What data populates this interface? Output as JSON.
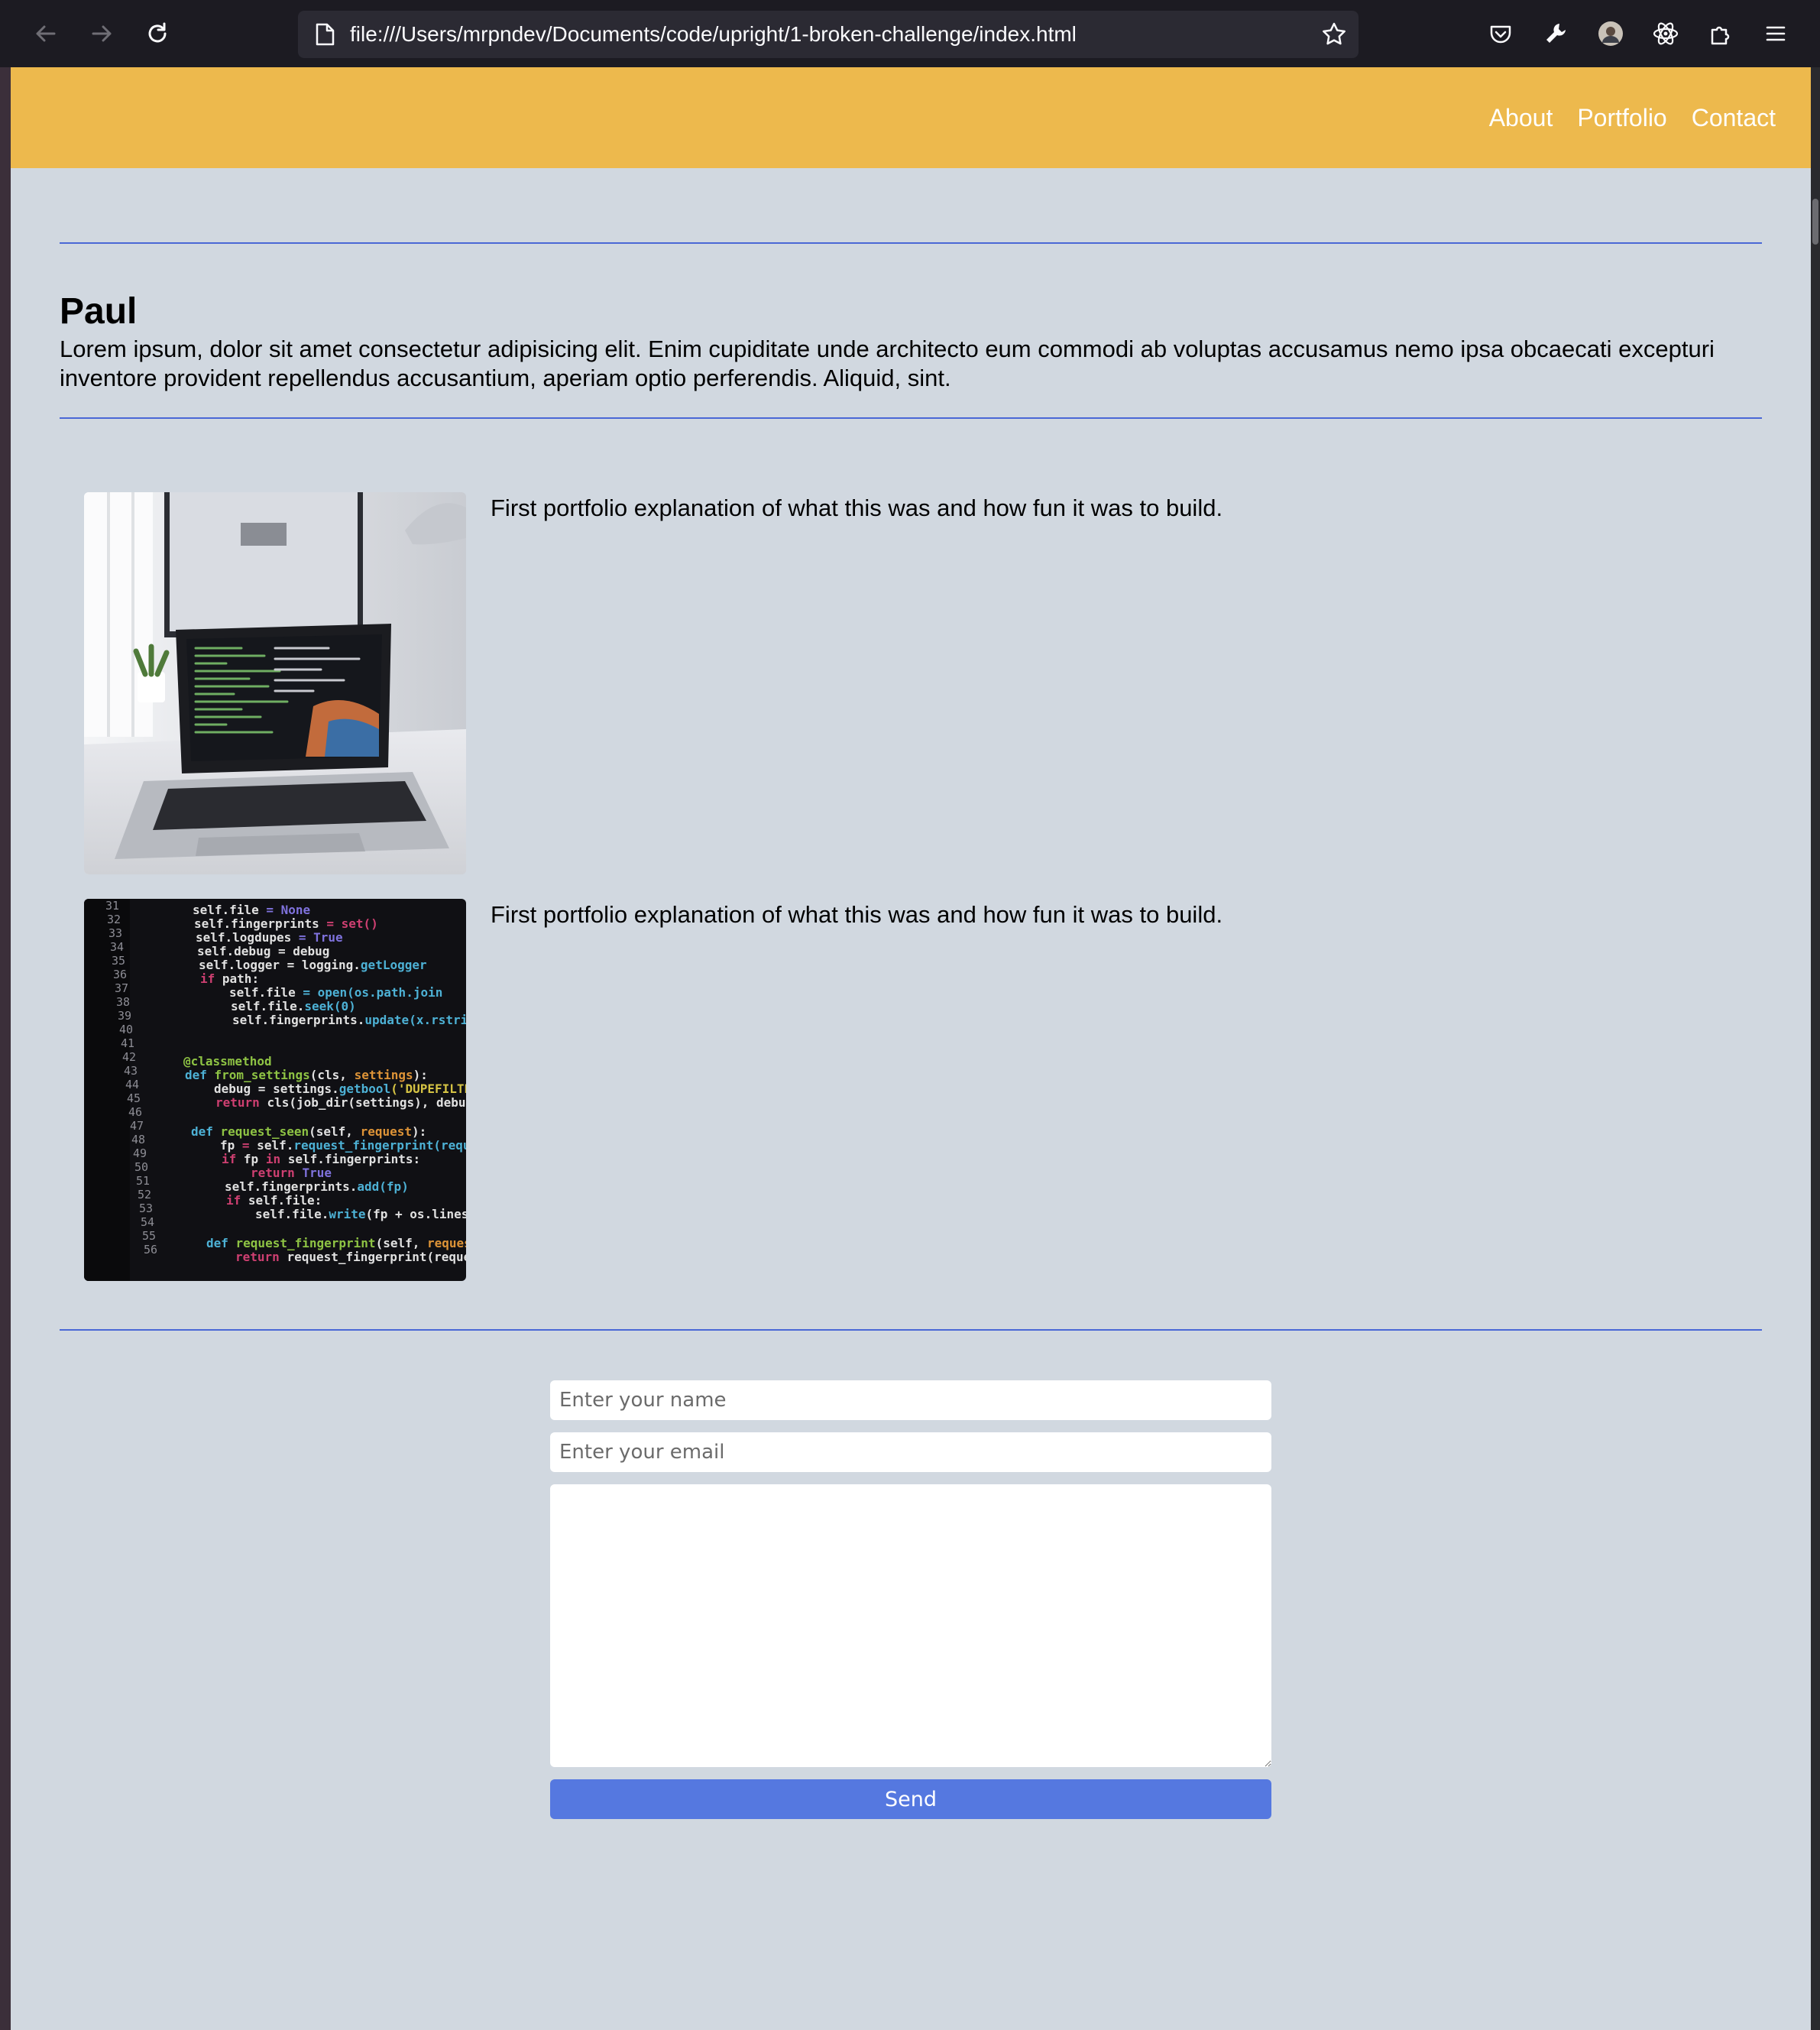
{
  "browser": {
    "url": "file:///Users/mrpndev/Documents/code/upright/1-broken-challenge/index.html",
    "toolbar_icons": [
      "back-arrow-icon",
      "forward-arrow-icon",
      "reload-icon",
      "page-icon",
      "bookmark-star-icon",
      "pocket-icon",
      "wrench-icon",
      "account-avatar-icon",
      "react-devtools-icon",
      "extensions-icon",
      "menu-icon"
    ]
  },
  "header": {
    "background": "#edb94d",
    "nav": [
      {
        "label": "About"
      },
      {
        "label": "Portfolio"
      },
      {
        "label": "Contact"
      }
    ]
  },
  "about": {
    "title": "Paul",
    "text": "Lorem ipsum, dolor sit amet consectetur adipisicing elit. Enim cupiditate unde architecto eum commodi ab voluptas accusamus nemo ipsa obcaecati excepturi inventore provident repellendus accusantium, aperiam optio perferendis. Aliquid, sint."
  },
  "portfolio": {
    "items": [
      {
        "image": "laptop-desk-photo",
        "description": "First portfolio explanation of what this was and how fun it was to build."
      },
      {
        "image": "code-screen-photo",
        "description": "First portfolio explanation of what this was and how fun it was to build."
      }
    ]
  },
  "contact": {
    "name_placeholder": "Enter your name",
    "email_placeholder": "Enter your email",
    "message_value": "",
    "send_label": "Send",
    "button_color": "#5578e0"
  },
  "colors": {
    "page_background": "#d1d8e0",
    "divider": "#4a68d6"
  }
}
